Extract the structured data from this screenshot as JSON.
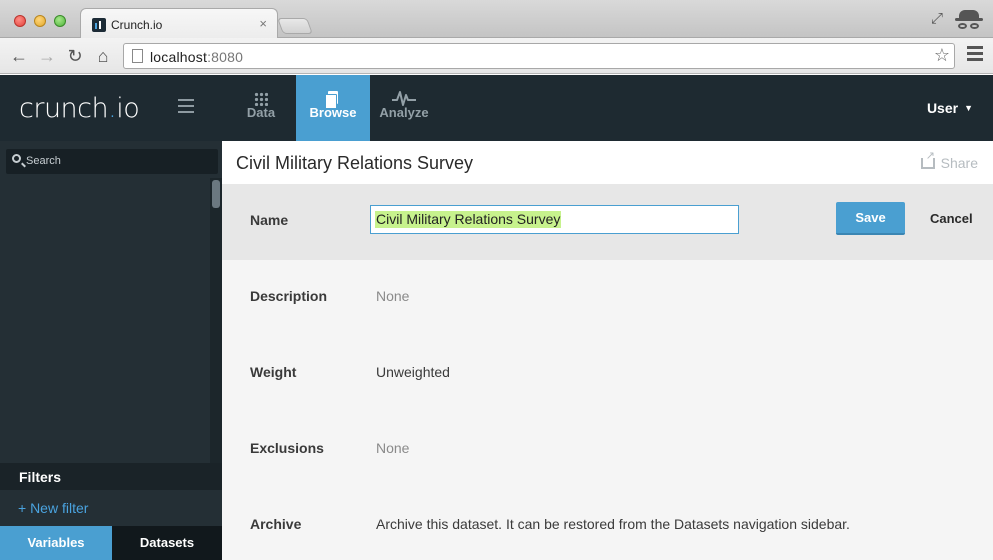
{
  "browser": {
    "tab_title": "Crunch.io",
    "tab_close": "×",
    "url_host": "localhost",
    "url_port": ":8080"
  },
  "app": {
    "logo_main": "crunch",
    "logo_dot": ".",
    "logo_suffix": "io",
    "nav": [
      {
        "label": "Data",
        "icon": "grid-icon",
        "active": false
      },
      {
        "label": "Browse",
        "icon": "documents-icon",
        "active": true
      },
      {
        "label": "Analyze",
        "icon": "pulse-icon",
        "active": false
      }
    ],
    "user_label": "User",
    "user_caret": "▼"
  },
  "sidebar": {
    "search_placeholder": "Search",
    "filters_title": "Filters",
    "new_filter": "+ New filter",
    "tabs": [
      {
        "label": "Variables",
        "active": true
      },
      {
        "label": "Datasets",
        "active": false
      }
    ]
  },
  "main": {
    "title": "Civil Military Relations Survey",
    "share_label": "Share",
    "name": {
      "label": "Name",
      "value": "Civil Military Relations Survey",
      "save_label": "Save",
      "cancel_label": "Cancel"
    },
    "fields": [
      {
        "label": "Description",
        "value": "None",
        "muted": true
      },
      {
        "label": "Weight",
        "value": "Unweighted",
        "muted": false
      },
      {
        "label": "Exclusions",
        "value": "None",
        "muted": true
      },
      {
        "label": "Archive",
        "value": "Archive this dataset. It can be restored from the Datasets navigation sidebar.",
        "muted": false
      }
    ]
  },
  "colors": {
    "header_bg": "#1e2a31",
    "accent": "#4a9fd1",
    "selection_highlight": "#c7f28d"
  }
}
